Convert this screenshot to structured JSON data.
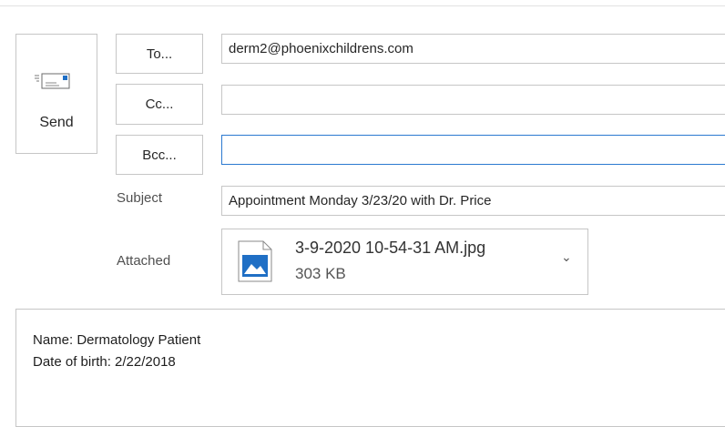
{
  "send": {
    "label": "Send",
    "icon": "send-envelope-icon"
  },
  "recipients": {
    "to": {
      "label": "To...",
      "value": "derm2@phoenixchildrens.com"
    },
    "cc": {
      "label": "Cc...",
      "value": ""
    },
    "bcc": {
      "label": "Bcc...",
      "value": ""
    }
  },
  "subject": {
    "label": "Subject",
    "value": "Appointment Monday 3/23/20 with Dr. Price"
  },
  "attachment": {
    "label": "Attached",
    "file_name": "3-9-2020 10-54-31 AM.jpg",
    "file_size": "303 KB",
    "icon": "image-file-icon",
    "chevron": "⌄"
  },
  "message": {
    "lines": [
      "Name: Dermatology Patient",
      "Date of birth: 2/22/2018"
    ]
  },
  "colors": {
    "border": "#c6c6c6",
    "focus": "#2b79d0",
    "accent": "#1f6fc5"
  }
}
